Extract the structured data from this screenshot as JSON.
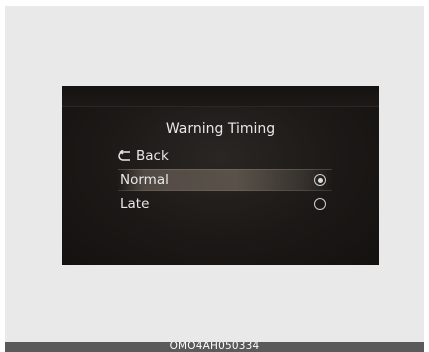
{
  "menu": {
    "title": "Warning Timing",
    "back_label": "Back",
    "options": [
      {
        "label": "Normal",
        "selected": true
      },
      {
        "label": "Late",
        "selected": false
      }
    ]
  },
  "caption": "OMO4AH050334",
  "icons": {
    "back": "back-arrow-icon",
    "radio_selected": "radio-selected-icon",
    "radio_unselected": "radio-unselected-icon"
  }
}
